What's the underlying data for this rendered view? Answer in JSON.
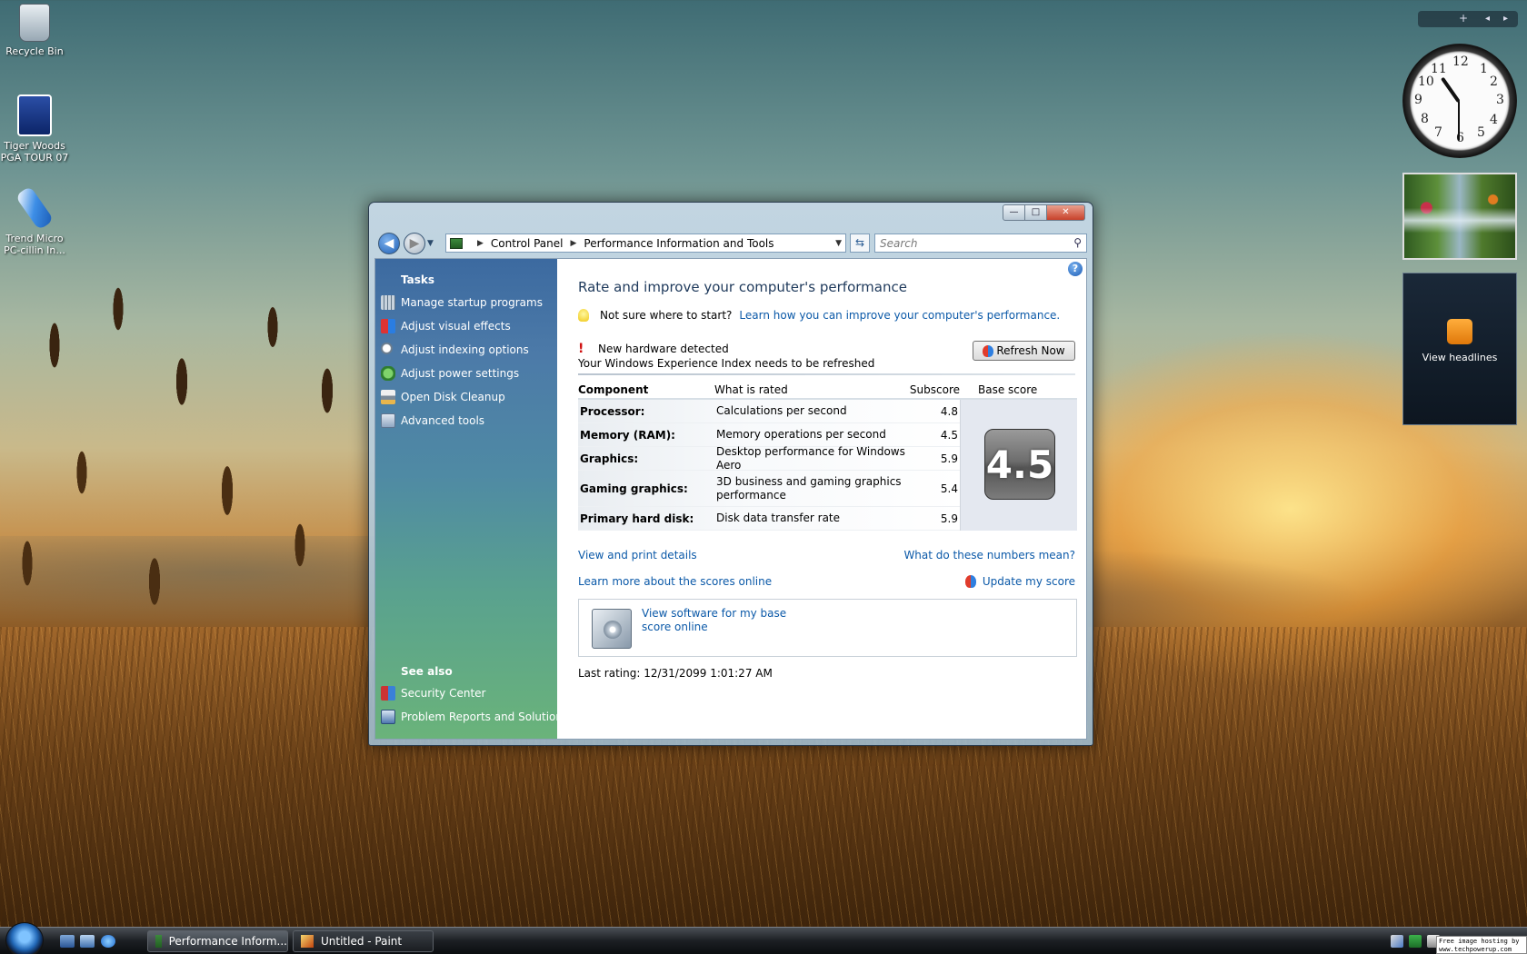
{
  "desktop": {
    "icons": [
      {
        "label": "Recycle Bin"
      },
      {
        "label": "Tiger Woods PGA TOUR 07"
      },
      {
        "label": "Trend Micro PC-cillin In..."
      }
    ]
  },
  "sidebar": {
    "toolbar": {
      "add": "+",
      "prev": "◂",
      "next": "▸"
    },
    "clock": {
      "numbers": [
        "12",
        "1",
        "2",
        "3",
        "4",
        "5",
        "6",
        "7",
        "8",
        "9",
        "10",
        "11"
      ]
    },
    "feed": {
      "label": "View headlines"
    }
  },
  "window": {
    "controls": {
      "minimize": "—",
      "maximize": "□",
      "close": "✕"
    },
    "breadcrumb": [
      "Control Panel",
      "Performance Information and Tools"
    ],
    "search_placeholder": "Search",
    "tasks": {
      "heading": "Tasks",
      "items": [
        {
          "label": "Manage startup programs"
        },
        {
          "label": "Adjust visual effects"
        },
        {
          "label": "Adjust indexing options"
        },
        {
          "label": "Adjust power settings"
        },
        {
          "label": "Open Disk Cleanup"
        },
        {
          "label": "Advanced tools"
        }
      ],
      "see_also_heading": "See also",
      "see_also": [
        {
          "label": "Security Center"
        },
        {
          "label": "Problem Reports and Solutions"
        }
      ]
    },
    "main": {
      "title": "Rate and improve your computer's performance",
      "hint_text": "Not sure where to start?",
      "hint_link": "Learn how you can improve your computer's performance.",
      "alert_title": "New hardware detected",
      "alert_body": "Your Windows Experience Index needs to be refreshed",
      "refresh_button": "Refresh Now",
      "table": {
        "headers": {
          "component": "Component",
          "what": "What is rated",
          "subscore": "Subscore",
          "base": "Base score"
        },
        "rows": [
          {
            "component": "Processor:",
            "what": "Calculations per second",
            "subscore": "4.8"
          },
          {
            "component": "Memory (RAM):",
            "what": "Memory operations per second",
            "subscore": "4.5"
          },
          {
            "component": "Graphics:",
            "what": "Desktop performance for Windows Aero",
            "subscore": "5.9"
          },
          {
            "component": "Gaming graphics:",
            "what": "3D business and gaming graphics performance",
            "subscore": "5.4"
          },
          {
            "component": "Primary hard disk:",
            "what": "Disk data transfer rate",
            "subscore": "5.9"
          }
        ],
        "base_score": "4.5"
      },
      "link_details": "View and print details",
      "link_meaning": "What do these numbers mean?",
      "link_learn": "Learn more about the scores online",
      "link_update": "Update my score",
      "software_link": "View software for my base score online",
      "last_rating": "Last rating: 12/31/2099 1:01:27 AM"
    }
  },
  "taskbar": {
    "buttons": [
      {
        "label": "Performance Inform..."
      },
      {
        "label": "Untitled - Paint"
      }
    ]
  },
  "watermark": {
    "line1": "Free image hosting by",
    "line2": "www.techpowerup.com"
  },
  "colors": {
    "link": "#0b59a8",
    "title": "#1e395b",
    "alert": "#d01010"
  }
}
